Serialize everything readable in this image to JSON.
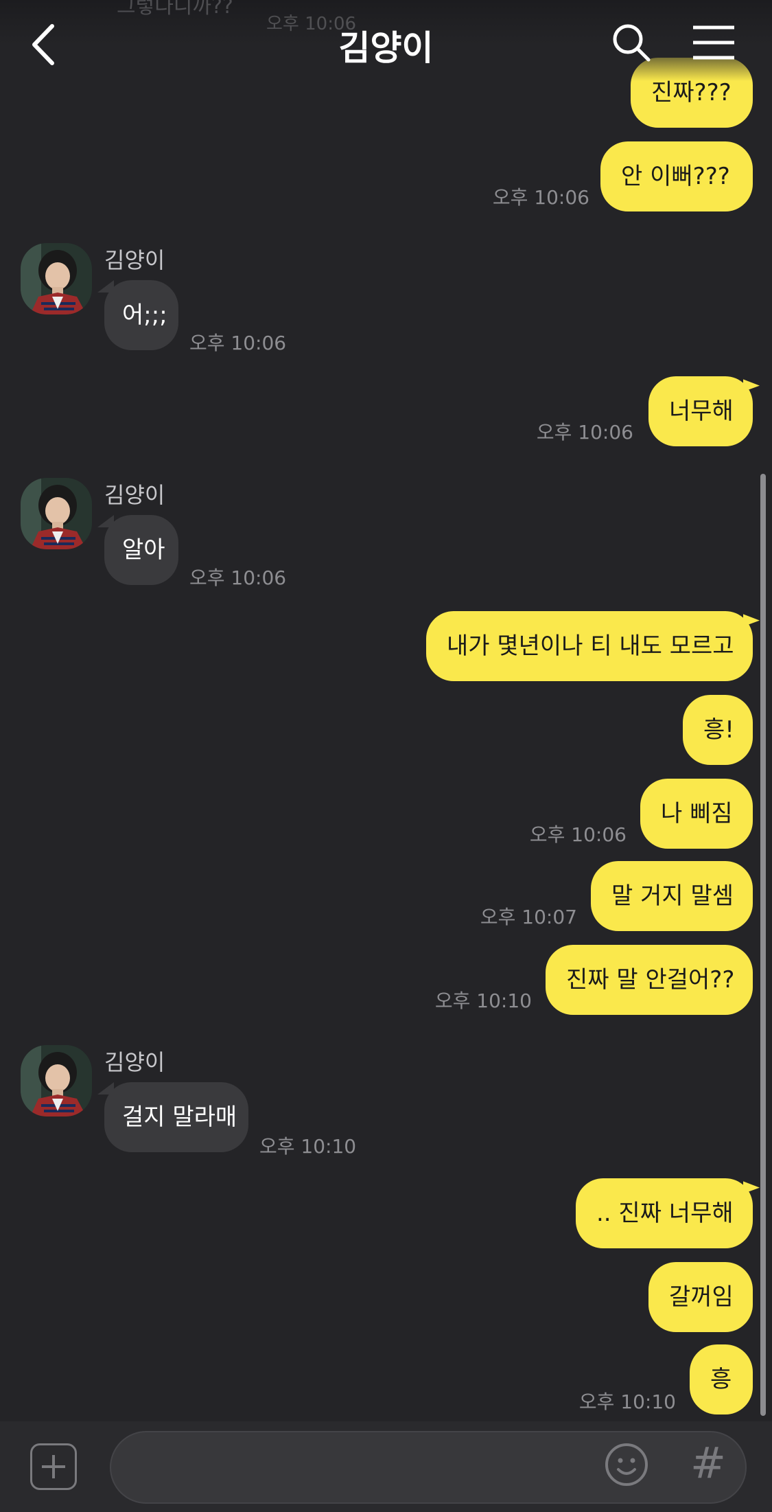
{
  "header": {
    "title": "김양이",
    "prev_partial_text": "그렇다니까??",
    "prev_partial_time": "오후 10:06"
  },
  "messages": [
    {
      "side": "me",
      "text": "진짜???",
      "time": ""
    },
    {
      "side": "me",
      "text": "안 이뻐???",
      "time": "오후 10:06"
    },
    {
      "side": "them",
      "sender": "김양이",
      "text": "어;;;",
      "time": "오후 10:06"
    },
    {
      "side": "me",
      "text": "너무해",
      "time": "오후 10:06"
    },
    {
      "side": "them",
      "sender": "김양이",
      "text": "알아",
      "time": "오후 10:06"
    },
    {
      "side": "me",
      "text": "내가 몇년이나 티 내도 모르고",
      "time": ""
    },
    {
      "side": "me",
      "text": "흥!",
      "time": ""
    },
    {
      "side": "me",
      "text": "나 삐짐",
      "time": "오후 10:06"
    },
    {
      "side": "me",
      "text": "말 거지 말셈",
      "time": "오후 10:07"
    },
    {
      "side": "me",
      "text": "진짜 말 안걸어??",
      "time": "오후 10:10"
    },
    {
      "side": "them",
      "sender": "김양이",
      "text": "걸지 말라매",
      "time": "오후 10:10"
    },
    {
      "side": "me",
      "text": ".. 진짜 너무해",
      "time": ""
    },
    {
      "side": "me",
      "text": "갈꺼임",
      "time": ""
    },
    {
      "side": "me",
      "text": "흥",
      "time": "오후 10:10"
    }
  ],
  "input": {
    "value": "",
    "hash_symbol": "#"
  },
  "colors": {
    "background": "#242427",
    "my_bubble": "#fae84c",
    "their_bubble": "#3a3a3d",
    "timestamp": "#8e8e92"
  },
  "icons": [
    "back-arrow-icon",
    "search-icon",
    "menu-icon",
    "plus-icon",
    "emoji-icon",
    "hash-icon"
  ]
}
